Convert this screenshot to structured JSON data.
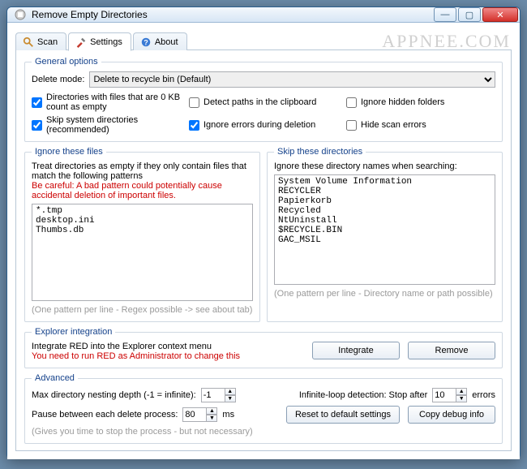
{
  "watermark": "APPNEE.COM",
  "window": {
    "title": "Remove Empty Directories"
  },
  "tabs": {
    "scan": "Scan",
    "settings": "Settings",
    "about": "About"
  },
  "general": {
    "legend": "General options",
    "delete_mode_label": "Delete mode:",
    "delete_mode_value": "Delete to recycle bin (Default)",
    "checks": {
      "zero_kb": {
        "label": "Directories with files that are 0 KB count as empty",
        "checked": true
      },
      "detect_clipboard": {
        "label": "Detect paths in the clipboard",
        "checked": false
      },
      "ignore_hidden": {
        "label": "Ignore hidden folders",
        "checked": false
      },
      "skip_system": {
        "label": "Skip system directories (recommended)",
        "checked": true
      },
      "ignore_errors": {
        "label": "Ignore errors during deletion",
        "checked": true
      },
      "hide_scan_errors": {
        "label": "Hide scan errors",
        "checked": false
      }
    }
  },
  "ignore_files": {
    "legend": "Ignore these files",
    "desc": "Treat directories as empty if they only contain files that match the following patterns",
    "warn": "Be careful: A bad pattern could potentially cause accidental deletion of important files.",
    "value": "*.tmp\ndesktop.ini\nThumbs.db",
    "hint": "(One pattern per line - Regex possible -> see about tab)"
  },
  "skip_dirs": {
    "legend": "Skip these directories",
    "desc": "Ignore these directory names when searching:",
    "value": "System Volume Information\nRECYCLER\nPapierkorb\nRecycled\nNtUninstall\n$RECYCLE.BIN\nGAC_MSIL",
    "hint": "(One pattern per line - Directory name or path possible)"
  },
  "explorer": {
    "legend": "Explorer integration",
    "desc": "Integrate RED into the Explorer context menu",
    "warn": "You need to run RED as Administrator to change this",
    "integrate_btn": "Integrate",
    "remove_btn": "Remove"
  },
  "advanced": {
    "legend": "Advanced",
    "max_depth_label": "Max directory nesting depth (-1 = infinite):",
    "max_depth_value": "-1",
    "pause_label": "Pause between each delete process:",
    "pause_value": "80",
    "pause_unit": "ms",
    "pause_hint": "(Gives you time to stop the process - but not necessary)",
    "loop_label_pre": "Infinite-loop detection: Stop after",
    "loop_value": "10",
    "loop_label_post": "errors",
    "reset_btn": "Reset to default settings",
    "copy_btn": "Copy debug info"
  }
}
